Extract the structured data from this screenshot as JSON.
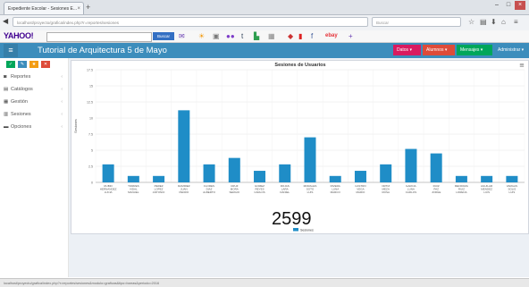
{
  "browser": {
    "tab_title": "Expediente Escolar - Sesiones E...",
    "tab_close": "×",
    "new_tab": "+",
    "url": "localhost/proyecto/grafica/index.php?r=reportes/sesiones",
    "search_placeholder": "Buscar",
    "win_buttons": [
      "–",
      "□",
      "×"
    ]
  },
  "yahoo": {
    "logo": "YAHOO!",
    "search_button": "Buscar",
    "ebay": "ebay"
  },
  "app": {
    "title": "Tutorial de Arquitectura 5 de Mayo",
    "header_buttons": [
      {
        "label": "Datos ▾",
        "color": "#d81b60"
      },
      {
        "label": "Alumnos ▾",
        "color": "#dd4b39"
      },
      {
        "label": "Mensajes ▾",
        "color": "#00a65a"
      },
      {
        "label": "Administrar ▾",
        "color": "#3c8dbc"
      }
    ]
  },
  "sidebar": {
    "buttons": [
      {
        "label": "✓",
        "color": "#00a65a"
      },
      {
        "label": "✎",
        "color": "#3c8dbc"
      },
      {
        "label": "★",
        "color": "#f39c12"
      },
      {
        "label": "✕",
        "color": "#dd4b39"
      }
    ],
    "items": [
      {
        "label": "Reportes",
        "icon": "◙"
      },
      {
        "label": "Catálogos",
        "icon": "▤"
      },
      {
        "label": "Gestión",
        "icon": "▦"
      },
      {
        "label": "Sesiones",
        "icon": "▥"
      },
      {
        "label": "Opciones",
        "icon": "▬"
      }
    ],
    "chevron": "‹"
  },
  "status_bar": "localhost/proyecto/grafica/index.php?r=reportes/sesiones&modulo=graficas&tipo=barras&periodo=2016",
  "overlay_number": "2599",
  "chart_data": {
    "type": "bar",
    "title": "Sesiones de Usuarios",
    "ylabel": "Sesiones",
    "ylim": [
      0,
      17.5
    ],
    "yticks": [
      "0",
      "2.5",
      "5",
      "7.5",
      "10",
      "12.5",
      "15",
      "17.5"
    ],
    "grid": true,
    "legend": "bottom-center",
    "series": [
      {
        "name": "Sesiones",
        "color": "#1f8dc7",
        "values": [
          2.8,
          1,
          1,
          11.2,
          2.8,
          3.8,
          1.8,
          2.8,
          7,
          1,
          1.8,
          2.8,
          5.2,
          4.5,
          1,
          1,
          1
        ]
      }
    ],
    "categories": [
      "RUBIO\nHERNANDEZ\nLUCIA",
      "TORRES\nVIDAL\nMANUEL",
      "PEREZ\nLOPEZ\nANTONIO",
      "RAMIREZ\nJUAN\nPEDRO",
      "FLORES\nDIAZ\nALBERTO",
      "CRUZ\nMORA\nSERGIO",
      "GOMEZ\nREYES\nCARLOS",
      "ROJAS\nLARA\nDANIEL",
      "MORALES\nSOTO\nLUIS",
      "RIVERA\nLUNA\nMARCO",
      "CASTRO\nVEGA\nMARIO",
      "ORTIZ\nMEZA\nROSA",
      "GARCIA\nLUNA\nCARLOS",
      "RUIZ\nPAZ\nJORGE",
      "MENDOZA\nRUIZ\nLORENA",
      "AGUILAR\nMENDEZ\nLUIS",
      "VARGAS\nSOLIS\nLUIS"
    ]
  }
}
